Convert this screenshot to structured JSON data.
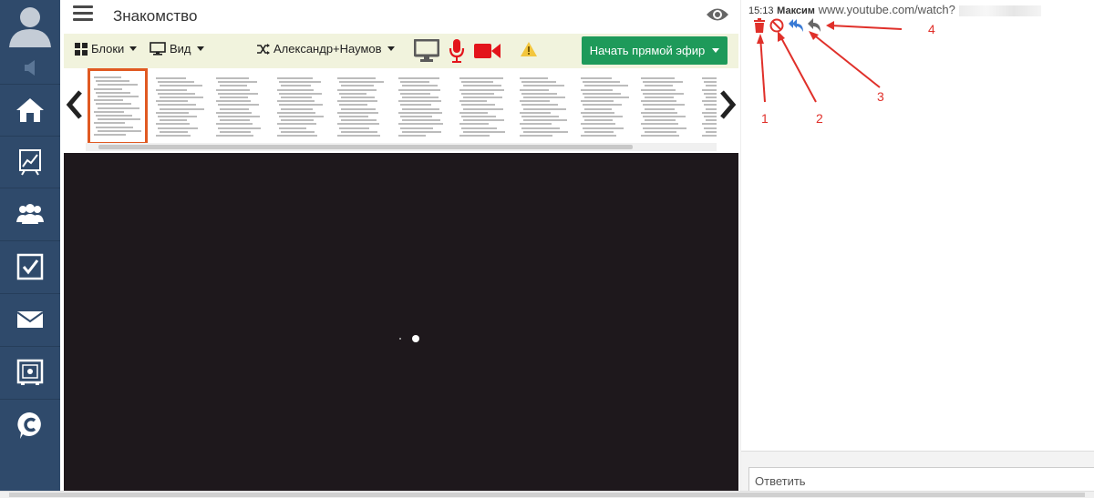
{
  "header": {
    "title": "Знакомство"
  },
  "toolbar": {
    "blocks_label": "Блоки",
    "view_label": "Вид",
    "users_label": "Александр+Наумов",
    "broadcast_label": "Начать прямой эфир"
  },
  "slides": {
    "count": 11,
    "active_index": 0
  },
  "chat": {
    "message": {
      "time": "15:13",
      "user": "Максим",
      "text": "www.youtube.com/watch?"
    },
    "annotations": [
      "1",
      "2",
      "3",
      "4"
    ],
    "reply_placeholder": "Ответить"
  },
  "colors": {
    "sidebar": "#2f4a6b",
    "toolbar": "#f1f3dd",
    "broadcast": "#1e9a5a",
    "active_thumb": "#e05a22",
    "annotation": "#e0302a",
    "delete": "#e0302a",
    "reply_all": "#3a7bd5",
    "reply": "#666666"
  },
  "icons": {
    "sidebar": [
      "avatar-icon",
      "volume-icon",
      "home-icon",
      "chart-icon",
      "users-icon",
      "checkbox-icon",
      "mail-icon",
      "safe-icon",
      "chat-c-icon"
    ],
    "toolbar": [
      "grid-icon",
      "monitor-icon",
      "shuffle-icon",
      "screen-icon",
      "microphone-icon",
      "camera-icon",
      "warning-icon"
    ],
    "chat_actions": [
      "trash-icon",
      "ban-icon",
      "reply-all-icon",
      "reply-icon"
    ]
  }
}
